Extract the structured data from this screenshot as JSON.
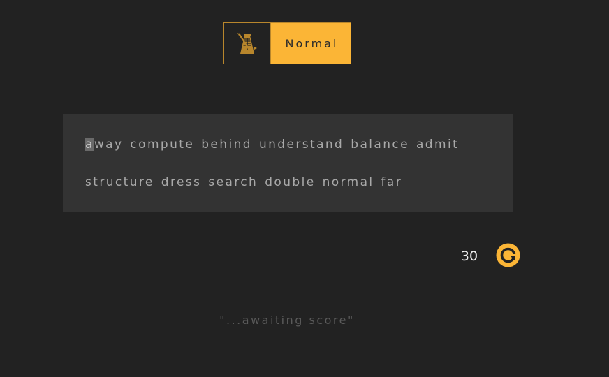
{
  "mode": {
    "icon": "metronome-icon",
    "label": "Normal"
  },
  "words": {
    "line1": [
      "away",
      "compute",
      "behind",
      "understand",
      "balance",
      "admit"
    ],
    "line2": [
      "structure",
      "dress",
      "search",
      "double",
      "normal",
      "far"
    ],
    "cursor_word_first_letter": "a",
    "cursor_word_rest": "way"
  },
  "timer": {
    "seconds": "30"
  },
  "restart": {
    "icon": "restart-icon"
  },
  "score_note": "\"...awaiting score\"",
  "colors": {
    "background": "#222222",
    "panel": "#333333",
    "accent": "#fbb536",
    "text": "#a9a9a9"
  }
}
